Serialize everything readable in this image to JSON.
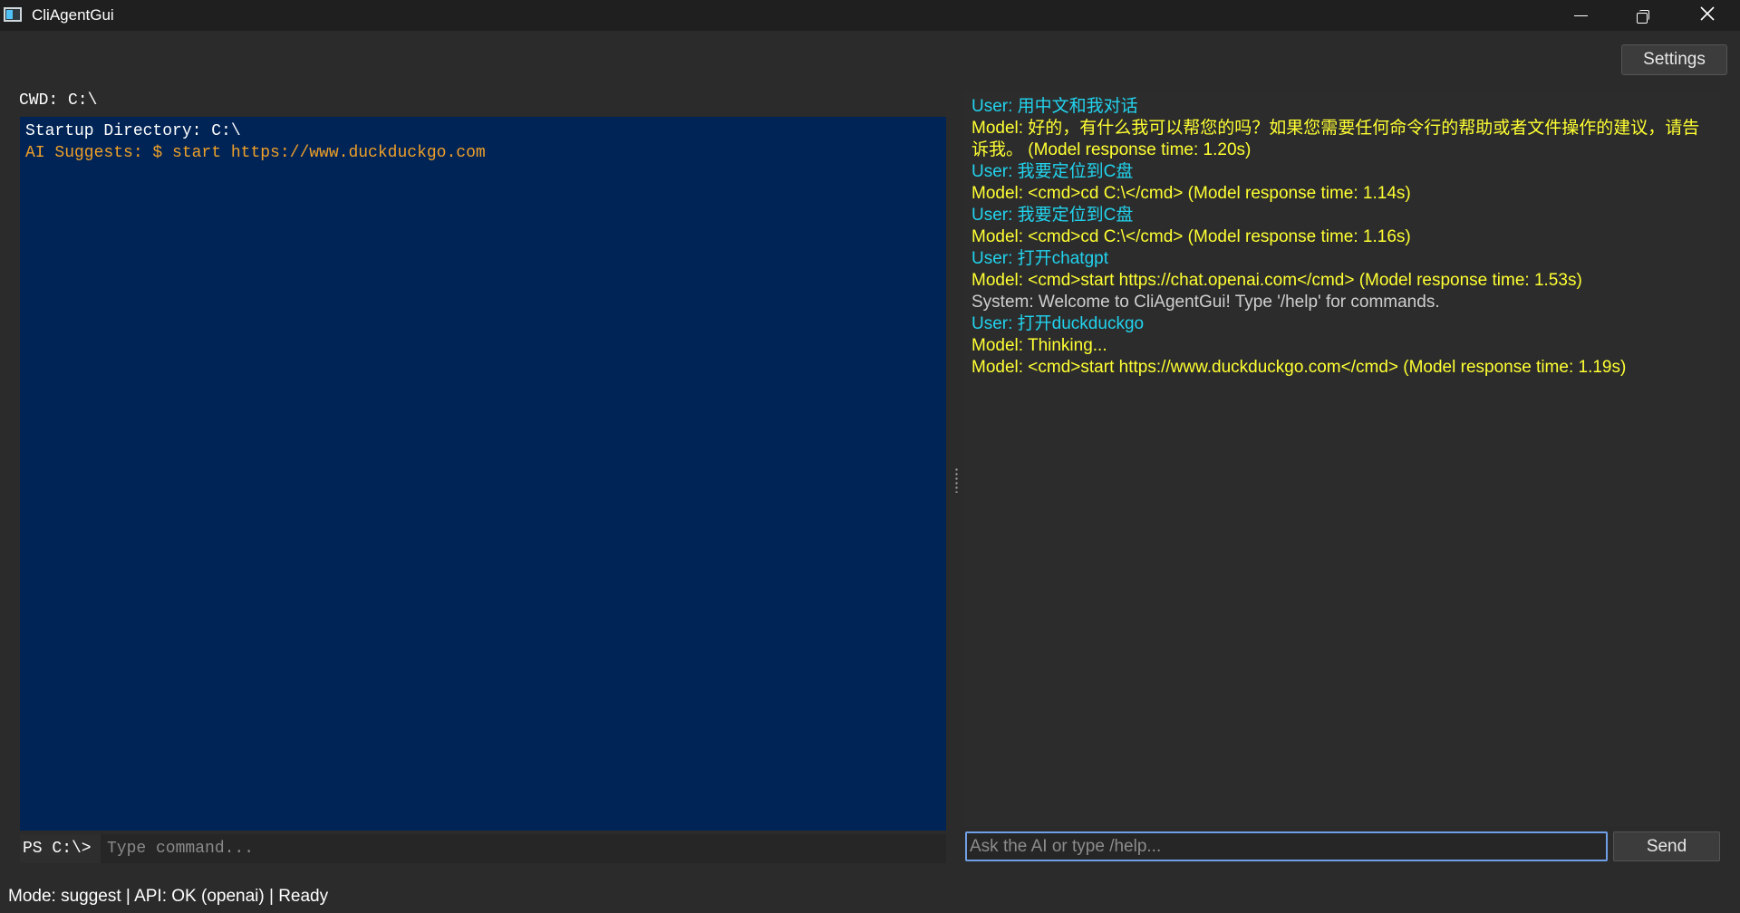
{
  "window": {
    "title": "CliAgentGui",
    "minimize_glyph": "minimize-icon",
    "maximize_glyph": "restore-icon",
    "close_glyph": "close-icon"
  },
  "toolbar": {
    "settings_label": "Settings"
  },
  "terminal": {
    "cwd_label": "CWD: C:\\",
    "lines": [
      {
        "text": "Startup Directory: C:\\",
        "style": "white"
      },
      {
        "text": "AI Suggests: $ start https://www.duckduckgo.com",
        "style": "orange"
      }
    ],
    "prompt": "PS C:\\>",
    "input_value": "",
    "input_placeholder": "Type command..."
  },
  "chat": {
    "messages": [
      {
        "role": "user",
        "text": "User: 用中文和我对话"
      },
      {
        "role": "model",
        "text": "Model: 好的，有什么我可以帮您的吗？如果您需要任何命令行的帮助或者文件操作的建议，请告诉我。 (Model response time: 1.20s)"
      },
      {
        "role": "user",
        "text": "User: 我要定位到C盘"
      },
      {
        "role": "model",
        "text": "Model: <cmd>cd C:\\</cmd> (Model response time: 1.14s)"
      },
      {
        "role": "user",
        "text": "User: 我要定位到C盘"
      },
      {
        "role": "model",
        "text": "Model: <cmd>cd C:\\</cmd> (Model response time: 1.16s)"
      },
      {
        "role": "user",
        "text": "User: 打开chatgpt"
      },
      {
        "role": "model",
        "text": "Model: <cmd>start https://chat.openai.com</cmd> (Model response time: 1.53s)"
      },
      {
        "role": "system",
        "text": "System: Welcome to CliAgentGui! Type '/help' for commands."
      },
      {
        "role": "user",
        "text": "User: 打开duckduckgo"
      },
      {
        "role": "model",
        "text": "Model: Thinking..."
      },
      {
        "role": "model",
        "text": "Model: <cmd>start https://www.duckduckgo.com</cmd> (Model response time: 1.19s)"
      }
    ],
    "input_value": "",
    "input_placeholder": "Ask the AI or type /help...",
    "send_label": "Send"
  },
  "status_bar": {
    "text": "Mode: suggest | API: OK (openai) | Ready"
  },
  "colors": {
    "terminal_bg": "#012456",
    "user_text": "#22d3ee",
    "model_text": "#ffff33",
    "system_text": "#cfcfcf",
    "suggest_text": "#f0a028",
    "window_bg": "#2b2b2b"
  }
}
